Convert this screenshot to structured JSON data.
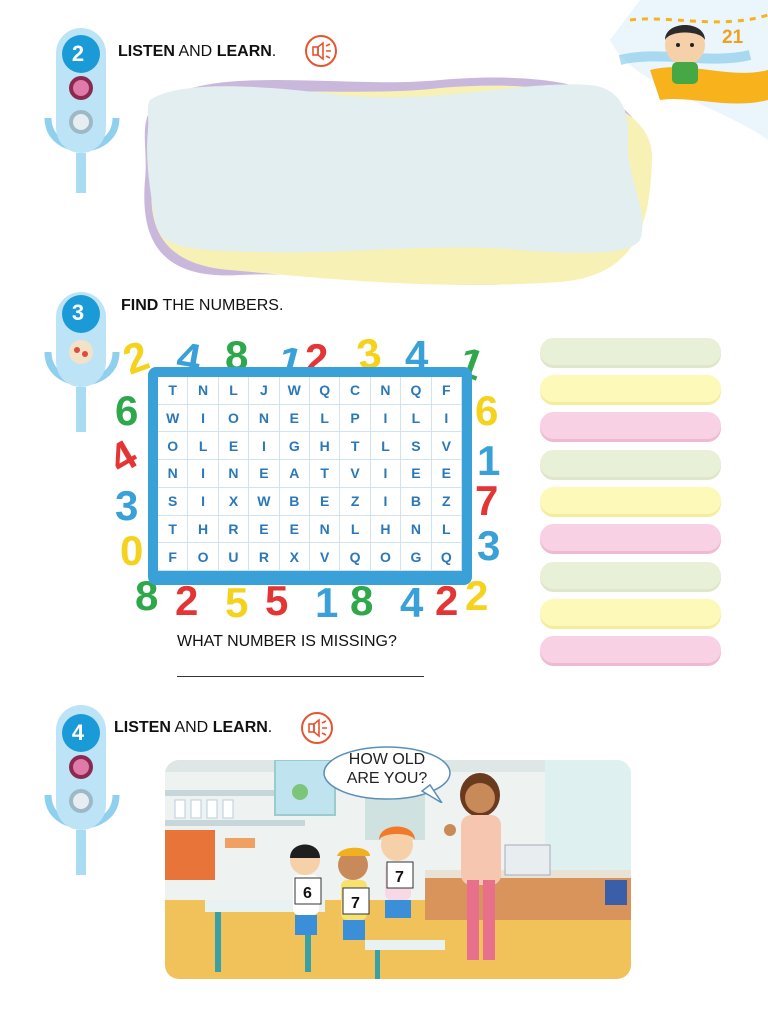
{
  "page": {
    "number": "21"
  },
  "sections": [
    {
      "number": "2",
      "instruction_bold": "LISTEN",
      "instruction_mid": " AND ",
      "instruction_bold2": "LEARN",
      "instruction_end": "."
    },
    {
      "number": "3",
      "instruction_bold": "FIND",
      "instruction_rest": " THE NUMBERS."
    },
    {
      "number": "4",
      "instruction_bold": "LISTEN",
      "instruction_mid": " AND ",
      "instruction_bold2": "LEARN",
      "instruction_end": "."
    }
  ],
  "word_search": {
    "rows": [
      [
        "T",
        "N",
        "L",
        "J",
        "W",
        "Q",
        "C",
        "N",
        "Q",
        "F"
      ],
      [
        "W",
        "I",
        "O",
        "N",
        "E",
        "L",
        "P",
        "I",
        "L",
        "I"
      ],
      [
        "O",
        "L",
        "E",
        "I",
        "G",
        "H",
        "T",
        "L",
        "S",
        "V"
      ],
      [
        "N",
        "I",
        "N",
        "E",
        "A",
        "T",
        "V",
        "I",
        "E",
        "E"
      ],
      [
        "S",
        "I",
        "X",
        "W",
        "B",
        "E",
        "Z",
        "I",
        "B",
        "Z"
      ],
      [
        "T",
        "H",
        "R",
        "E",
        "E",
        "N",
        "L",
        "H",
        "N",
        "L"
      ],
      [
        "F",
        "O",
        "U",
        "R",
        "X",
        "V",
        "Q",
        "O",
        "G",
        "Q"
      ]
    ]
  },
  "question": "WHAT NUMBER IS MISSING?",
  "answer_bars": [
    "green",
    "yellow",
    "pink",
    "green",
    "yellow",
    "pink",
    "green",
    "yellow",
    "pink"
  ],
  "scene": {
    "bubble_line1": "HOW OLD",
    "bubble_line2": "ARE YOU?",
    "cards": [
      "6",
      "7",
      "7"
    ]
  },
  "colors": {
    "accent_blue": "#1a9ad6",
    "speaker_orange": "#e8542e",
    "page_number": "#f0a020"
  }
}
